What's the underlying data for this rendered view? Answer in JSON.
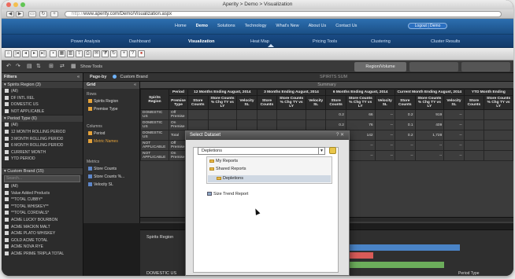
{
  "window": {
    "title": "Aperity > Demo > Visualization"
  },
  "browser": {
    "url": "www.aperity.com/Demo/Visualization.aspx",
    "url_prefix": "http://"
  },
  "appnav": {
    "items": [
      "Home",
      "Demo",
      "Solutions",
      "Technology",
      "What's New",
      "About Us",
      "Contact Us"
    ],
    "active": "Demo",
    "logout": "Logout | Demo"
  },
  "subnav": {
    "items": [
      "Power Analysis",
      "Dashboard",
      "Visualization",
      "Heat Map",
      "Pricing Tools",
      "Clustering",
      "Cluster Results"
    ],
    "active": "Visualization"
  },
  "toolbar2": {
    "show_tools": "Show Tools",
    "tabs": [
      "Region/Volume",
      "",
      ""
    ]
  },
  "filters": {
    "title": "Filters",
    "spirits_region": {
      "label": "Spirits Region (3)",
      "items": [
        "(All)",
        "DF INTL REL",
        "DOMESTIC US",
        "NOT APPLICABLE"
      ]
    },
    "period_type": {
      "label": "Period Type (6)",
      "items": [
        "(All)",
        "12 MONTH ROLLING PERIOD",
        "3 MONTH ROLLING PERIOD",
        "6 MONTH ROLLING PERIOD",
        "CURRENT MONTH",
        "YTD PERIOD"
      ]
    },
    "custom_brand": {
      "label": "Custom Brand (15)",
      "search_placeholder": "Search...",
      "items": [
        "(All)",
        "Value Added Products",
        "**TOTAL CUBBY*",
        "**TOTAL WHISKEY**",
        "**TOTAL CORDIALS*",
        "ACME LUCKY BOURBON",
        "ACME MACKIN MALT",
        "ACME PLATO WHISKEY",
        "GOLD ACME TOTAL",
        "ACME NOVA RYE",
        "ACME PRIME TRIPLA TOTAL"
      ]
    }
  },
  "pageby": {
    "label": "Page-by",
    "value": "Custom Brand",
    "center": "SPIRITS SUM"
  },
  "grid": {
    "title": "Grid",
    "rows_label": "Rows",
    "rows": [
      "Spirits Region",
      "Premise Type"
    ],
    "columns_label": "Columns",
    "columns": [
      "Period",
      "Metric Names"
    ],
    "metrics_label": "Metrics",
    "metrics": [
      "Store Counts",
      "Store Counts %...",
      "Velocity SL"
    ]
  },
  "summary": {
    "title": "Summary",
    "col_spirits_region": "Spirits Region",
    "col_period": "Period",
    "col_premise_type": "Premise Type",
    "groups": [
      "12 Months Ending August, 2014",
      "3 Months Ending August, 2014",
      "6 Months Ending August, 2014",
      "Current Month Ending August, 2014",
      "YTD Month Ending"
    ],
    "metric_headers": [
      "Store Counts",
      "Store Counts % Chg TY vs LY",
      "Velocity SL"
    ],
    "rows": [
      {
        "region": "DOMESTIC US",
        "premise": "Off Premise",
        "vals": [
          "",
          "",
          "",
          "",
          "",
          "",
          "0.2",
          "66",
          "--",
          "0.2",
          "919",
          "--"
        ]
      },
      {
        "region": "DOMESTIC US",
        "premise": "On Premise",
        "vals": [
          "",
          "",
          "",
          "",
          "",
          "",
          "0.2",
          "76",
          "--",
          "0.1",
          "409",
          "--"
        ]
      },
      {
        "region": "DOMESTIC US",
        "premise": "Total",
        "vals": [
          "",
          "",
          "",
          "",
          "",
          "",
          "0.2",
          "142",
          "--",
          "0.2",
          "1,728",
          "--"
        ]
      },
      {
        "region": "NOT APPLICABLE",
        "premise": "Off Premise",
        "vals": [
          "",
          "",
          "",
          "",
          "",
          "",
          "--",
          "--",
          "--",
          "--",
          "--",
          "--"
        ]
      },
      {
        "region": "NOT APPLICABLE",
        "premise": "On Premise",
        "vals": [
          "",
          "",
          "",
          "",
          "",
          "",
          "--",
          "--",
          "--",
          "--",
          "--",
          "--"
        ]
      }
    ]
  },
  "bottom": {
    "axis_label": "Spirits Region",
    "row_label": "DOMESTIC US",
    "legend_label": "Period Type"
  },
  "dialog": {
    "title": "Select Dataset",
    "dataset": "Depletions",
    "tree": [
      "My Reports",
      "Shared Reports",
      "Depletions"
    ],
    "report": "Size Trend Report"
  }
}
